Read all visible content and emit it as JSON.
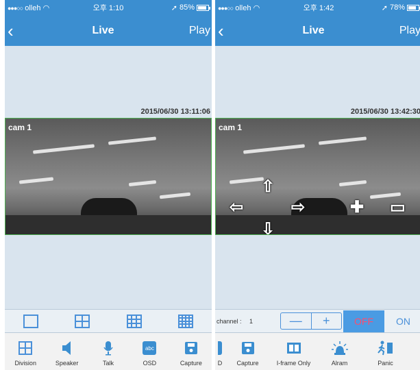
{
  "colors": {
    "accent": "#3b8ed0",
    "off_text": "#ff4d6d",
    "video_border": "#4caf50"
  },
  "left": {
    "status": {
      "carrier": "olleh",
      "time": "오후 1:10",
      "battery": "85%",
      "battery_level": 0.85
    },
    "nav": {
      "back_icon": "chevron-left-icon",
      "title": "Live",
      "play": "Play"
    },
    "timestamp": "2015/06/30 13:11:06",
    "cam_label": "cam 1",
    "division_icons": [
      "single-view-icon",
      "quad-view-icon",
      "nine-view-icon",
      "sixteen-view-icon"
    ],
    "tabs": [
      {
        "label": "Division",
        "icon": "grid-icon"
      },
      {
        "label": "Speaker",
        "icon": "speaker-icon"
      },
      {
        "label": "Talk",
        "icon": "microphone-icon"
      },
      {
        "label": "OSD",
        "icon": "osd-icon"
      },
      {
        "label": "Capture",
        "icon": "save-icon"
      }
    ]
  },
  "right": {
    "status": {
      "carrier": "olleh",
      "time": "오후 1:42",
      "battery": "78%",
      "battery_level": 0.78
    },
    "nav": {
      "back_icon": "chevron-left-icon",
      "title": "Live",
      "play": "Play"
    },
    "timestamp": "2015/06/30 13:42:30",
    "cam_label": "cam 1",
    "ptz_icons": [
      "arrow-up-icon",
      "arrow-left-icon",
      "arrow-right-icon",
      "arrow-down-icon",
      "zoom-in-icon",
      "zoom-out-icon"
    ],
    "control": {
      "channel_label": "channel :",
      "channel_value": "1",
      "minus": "—",
      "plus": "+",
      "off": "OFF",
      "on": "ON"
    },
    "tabs": [
      {
        "label": "D",
        "icon": "partial-icon"
      },
      {
        "label": "Capture",
        "icon": "save-icon"
      },
      {
        "label": "I-frame Only",
        "icon": "iframe-icon"
      },
      {
        "label": "Alram",
        "icon": "alarm-light-icon"
      },
      {
        "label": "Panic",
        "icon": "panic-icon"
      }
    ]
  }
}
